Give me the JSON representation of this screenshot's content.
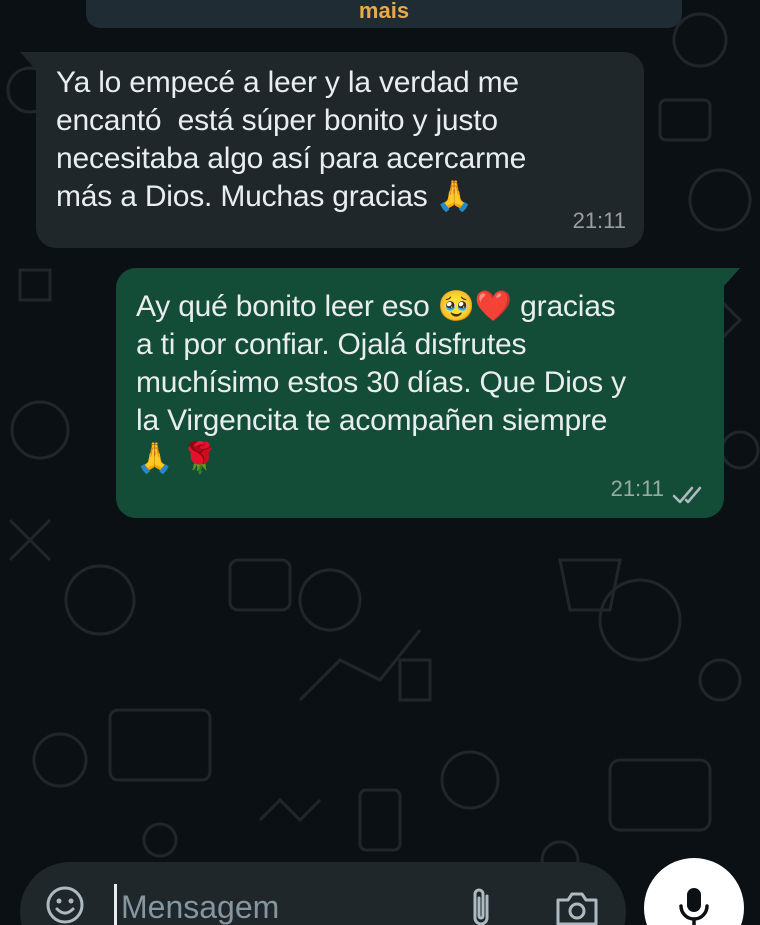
{
  "top_fragment": {
    "text": "mais"
  },
  "messages": [
    {
      "direction": "incoming",
      "text": "Ya lo empecé a leer y la verdad me\nencantó  está súper bonito y justo\nnecesitaba algo así para acercarme\nmás a Dios. Muchas gracias 🙏",
      "time": "21:11"
    },
    {
      "direction": "outgoing",
      "text": "Ay qué bonito leer eso 🥹❤️ gracias\na ti por confiar. Ojalá disfrutes\nmuchísimo estos 30 días. Que Dios y\nla Virgencita te acompañen siempre\n🙏 🌹",
      "time": "21:11",
      "status_icon": "double-check-icon"
    }
  ],
  "composer": {
    "placeholder": "Mensagem",
    "emoji_icon": "sticker-emoji-icon",
    "attach_icon": "paperclip-icon",
    "camera_icon": "camera-icon",
    "mic_icon": "microphone-icon"
  },
  "colors": {
    "background": "#0b1014",
    "incoming_bubble": "#1f272b",
    "outgoing_bubble": "#144d37",
    "accent_name": "#e9a94a"
  }
}
